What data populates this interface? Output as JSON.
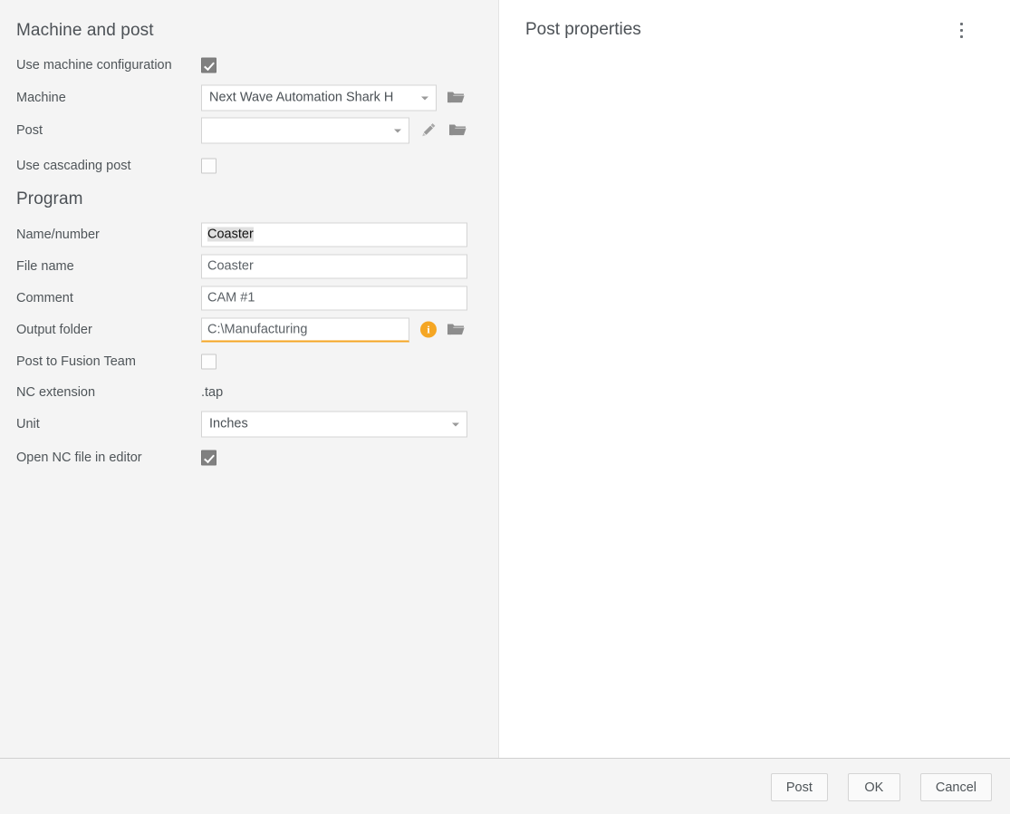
{
  "colors": {
    "panel_bg": "#f4f4f4",
    "content_bg": "#ffffff",
    "text": "#4f5559",
    "accent_warning": "#f5a623",
    "checkbox_checked": "#808080",
    "border": "#d4d4d4"
  },
  "left_panel": {
    "sections": [
      {
        "title": "Machine and post",
        "rows": [
          {
            "label": "Use machine configuration",
            "type": "checkbox",
            "checked": true
          },
          {
            "label": "Machine",
            "type": "combo",
            "value": "Next Wave Automation Shark H",
            "icons": [
              "folder-open-icon"
            ]
          },
          {
            "label": "Post",
            "type": "combo",
            "value": "",
            "icons": [
              "pencil-icon",
              "folder-open-icon"
            ]
          },
          {
            "label": "Use cascading post",
            "type": "checkbox",
            "checked": false
          }
        ]
      },
      {
        "title": "Program",
        "rows": [
          {
            "label": "Name/number",
            "type": "text",
            "value": "Coaster",
            "focused": true
          },
          {
            "label": "File name",
            "type": "text",
            "value": "Coaster"
          },
          {
            "label": "Comment",
            "type": "text",
            "value": "CAM #1"
          },
          {
            "label": "Output folder",
            "type": "text",
            "value": "C:\\Manufacturing",
            "warning": true,
            "icons": [
              "info-icon",
              "folder-open-icon"
            ]
          },
          {
            "label": "Post to Fusion Team",
            "type": "checkbox",
            "checked": false
          },
          {
            "label": "NC extension",
            "type": "static",
            "value": ".tap"
          },
          {
            "label": "Unit",
            "type": "combo",
            "value": "Inches"
          },
          {
            "label": "Open NC file in editor",
            "type": "checkbox",
            "checked": true
          }
        ]
      }
    ]
  },
  "right_panel": {
    "title": "Post properties",
    "menu_icon": "kebab-menu-icon",
    "body_items": []
  },
  "footer": {
    "buttons": [
      {
        "label": "Post",
        "name": "post-button"
      },
      {
        "label": "OK",
        "name": "ok-button"
      },
      {
        "label": "Cancel",
        "name": "cancel-button"
      }
    ]
  }
}
